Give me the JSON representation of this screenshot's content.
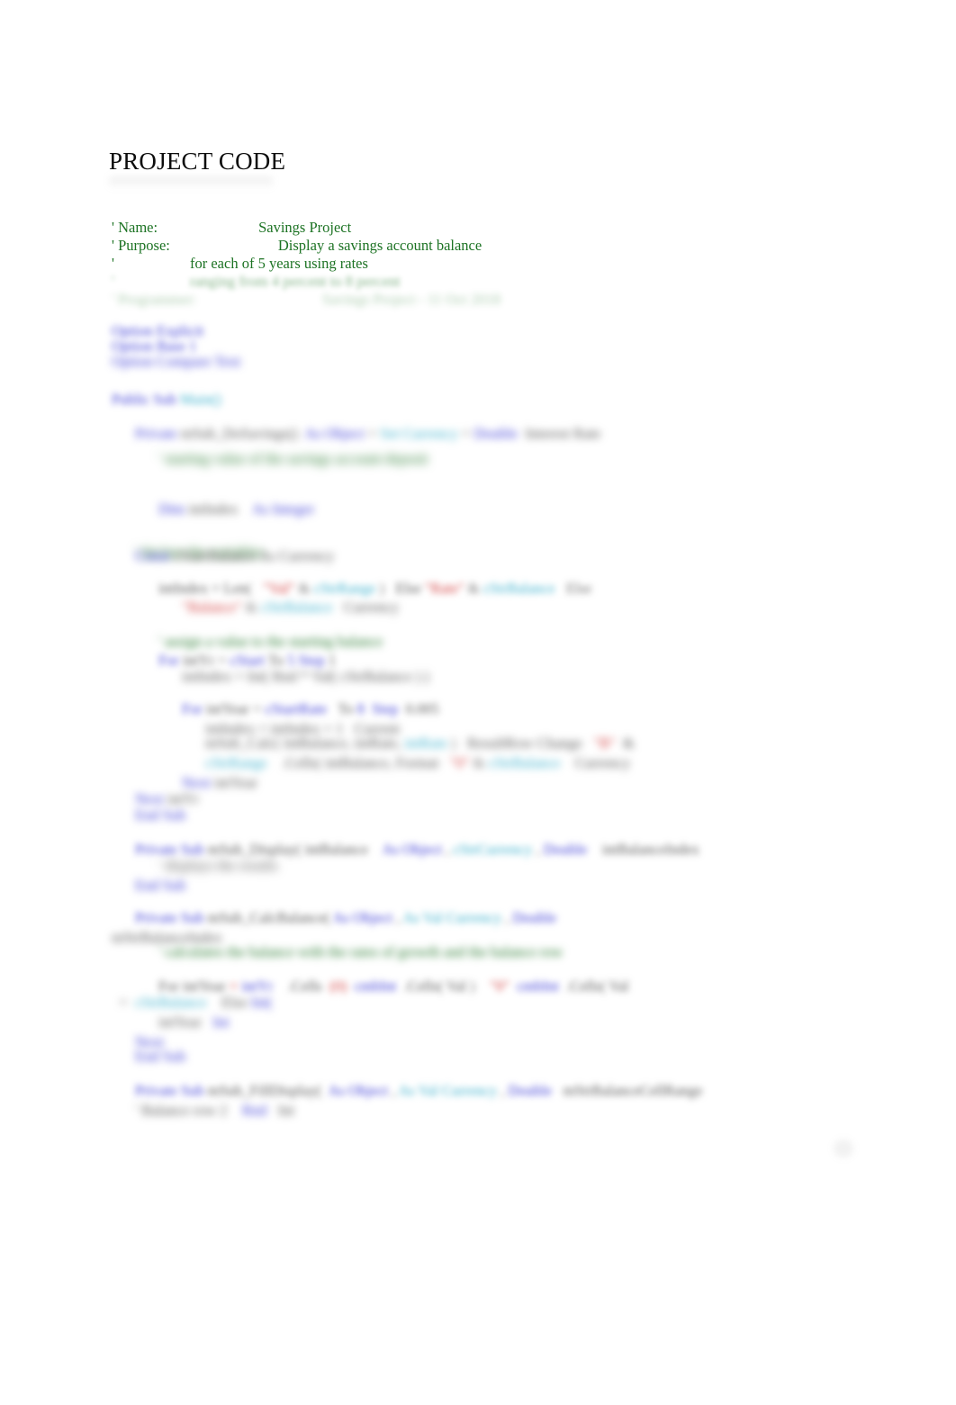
{
  "document": {
    "title": "PROJECT CODE",
    "page_marker": "1"
  },
  "colors": {
    "comment": "#1d7324",
    "keyword": "#3b3bd6",
    "identifier": "#555555",
    "type": "#37aecb",
    "string": "#d03b3b",
    "punctuation": "#6d6d6d",
    "text": "#0d0d0d",
    "background": "#ffffff"
  },
  "header_comments": [
    {
      "label": "' Name:",
      "value": "Savings Project"
    },
    {
      "label": "' Purpose:",
      "value": "Display a savings account balance"
    },
    {
      "label": "'",
      "value": "for each of 5 years using rates"
    },
    {
      "label": "'",
      "value": "ranging from 4 percent to 8 percent"
    },
    {
      "label": "' Programmer:",
      "value": "Savings Project - 11 Oct 2018"
    }
  ],
  "code_lines": [
    {
      "indent": 0,
      "blur": 3,
      "tokens": [
        {
          "cls": "t-kw",
          "text": "Option Explicit"
        }
      ]
    },
    {
      "indent": 0,
      "blur": 3,
      "tokens": [
        {
          "cls": "t-kw",
          "text": "Option Base 1"
        }
      ]
    },
    {
      "indent": 0,
      "blur": 4,
      "tokens": [
        {
          "cls": "t-kw",
          "text": "Option Compare Text"
        }
      ]
    },
    {
      "indent": 0,
      "blur": 3,
      "tokens": [
        {
          "cls": "t-kw",
          "text": "Public Sub "
        },
        {
          "cls": "t-type",
          "text": "Main()"
        }
      ]
    },
    {
      "indent": 1,
      "blur": 4,
      "tokens": [
        {
          "cls": "t-kw",
          "text": "Private "
        },
        {
          "cls": "t-id",
          "text": "mSub_DoSavings()  "
        },
        {
          "cls": "t-kw",
          "text": "As Object"
        },
        {
          "cls": "t-pun",
          "text": " = "
        },
        {
          "cls": "t-type",
          "text": "Set Currency"
        },
        {
          "cls": "t-pun",
          "text": " = "
        },
        {
          "cls": "t-kw",
          "text": "Double"
        },
        {
          "cls": "t-id",
          "text": "  Interest Rate"
        }
      ]
    },
    {
      "indent": 2,
      "blur": 5,
      "tokens": [
        {
          "cls": "t-cmt",
          "text": "' starting value of the savings account deposit"
        }
      ]
    },
    {
      "indent": 2,
      "blur": 4,
      "tokens": [
        {
          "cls": "t-kw",
          "text": "Dim "
        },
        {
          "cls": "t-id",
          "text": "intIndex    "
        },
        {
          "cls": "t-kw",
          "text": "As Integer"
        }
      ]
    },
    {
      "indent": 1,
      "blur": 5,
      "tokens": [
        {
          "cls": "t-cmt",
          "text": "' declare the variables"
        }
      ]
    },
    {
      "indent": 1,
      "blur": 4,
      "tokens": [
        {
          "cls": "t-kw",
          "text": "Const "
        },
        {
          "cls": "t-id",
          "text": "cStartBalance As Currency"
        }
      ]
    },
    {
      "indent": 2,
      "blur": 3,
      "tokens": [
        {
          "cls": "t-id",
          "text": "intIndex = Len"
        },
        {
          "cls": "t-pun",
          "text": "(   "
        },
        {
          "cls": "t-str",
          "text": "\"Val\""
        },
        {
          "cls": "t-pun",
          "text": " & "
        },
        {
          "cls": "t-type",
          "text": "cStrRange"
        },
        {
          "cls": "t-pun",
          "text": " )   "
        },
        {
          "cls": "t-id",
          "text": "Else "
        },
        {
          "cls": "t-str",
          "text": "\"Rate\""
        },
        {
          "cls": "t-pun",
          "text": " & "
        },
        {
          "cls": "t-type",
          "text": "cStrBalance"
        },
        {
          "cls": "t-pun",
          "text": "   Else"
        }
      ]
    },
    {
      "indent": 3,
      "blur": 4,
      "tokens": [
        {
          "cls": "t-str",
          "text": "\"Balance\""
        },
        {
          "cls": "t-pun",
          "text": " & "
        },
        {
          "cls": "t-type",
          "text": "cStrBalance"
        },
        {
          "cls": "t-id",
          "text": "   Currency"
        }
      ]
    },
    {
      "indent": 2,
      "blur": 4,
      "tokens": [
        {
          "cls": "t-cmt",
          "text": "' assign a value to the starting balance"
        }
      ]
    },
    {
      "indent": 2,
      "blur": 3,
      "tokens": [
        {
          "cls": "t-kw",
          "text": "For "
        },
        {
          "cls": "t-id",
          "text": "intYr"
        },
        {
          "cls": "t-pun",
          "text": " = "
        },
        {
          "cls": "t-kw",
          "text": "cStart "
        },
        {
          "cls": "t-id",
          "text": "To "
        },
        {
          "cls": "t-kw",
          "text": "5 "
        },
        {
          "cls": "t-kw",
          "text": "Step "
        },
        {
          "cls": "t-id",
          "text": "1"
        }
      ]
    },
    {
      "indent": 3,
      "blur": 4,
      "tokens": [
        {
          "cls": "t-id",
          "text": "intIndex = Int( Rnd * Val( cStrBalance ) )"
        }
      ]
    },
    {
      "indent": 3,
      "blur": 3,
      "tokens": [
        {
          "cls": "t-kw",
          "text": "For "
        },
        {
          "cls": "t-id",
          "text": "intYear"
        },
        {
          "cls": "t-pun",
          "text": " = "
        },
        {
          "cls": "t-kw",
          "text": "cStartRate"
        },
        {
          "cls": "t-id",
          "text": "   To "
        },
        {
          "cls": "t-kw",
          "text": "8  "
        },
        {
          "cls": "t-kw",
          "text": "Step"
        },
        {
          "cls": "t-id",
          "text": "  0.005"
        }
      ]
    },
    {
      "indent": 4,
      "blur": 4,
      "tokens": [
        {
          "cls": "t-id",
          "text": "intIndex = intIndex + 1   Current"
        }
      ]
    },
    {
      "indent": 4,
      "blur": 4,
      "tokens": [
        {
          "cls": "t-id",
          "text": "mSub_Calc( intBalance, intRate, "
        },
        {
          "cls": "t-type",
          "text": "intRate"
        },
        {
          "cls": "t-pun",
          "text": " ) "
        },
        {
          "cls": "t-id",
          "text": "  ResultRow Change"
        },
        {
          "cls": "t-str",
          "text": "   \"B\""
        },
        {
          "cls": "t-id",
          "text": "  &"
        }
      ]
    },
    {
      "indent": 4,
      "blur": 4,
      "tokens": [
        {
          "cls": "t-type",
          "text": "cStrRange"
        },
        {
          "cls": "t-id",
          "text": "    .Cells( intBalance, Format"
        },
        {
          "cls": "t-str",
          "text": "   \"0\""
        },
        {
          "cls": "t-pun",
          "text": " & "
        },
        {
          "cls": "t-type",
          "text": "cStrBalance"
        },
        {
          "cls": "t-id",
          "text": "    Currency"
        }
      ]
    },
    {
      "indent": 3,
      "blur": 4,
      "tokens": [
        {
          "cls": "t-kw",
          "text": "Next "
        },
        {
          "cls": "t-id",
          "text": "intYear"
        }
      ]
    },
    {
      "indent": 1,
      "blur": 4,
      "tokens": [
        {
          "cls": "t-kw",
          "text": "Next"
        },
        {
          "cls": "t-id",
          "text": " intYr"
        }
      ]
    },
    {
      "indent": 1,
      "blur": 4,
      "tokens": [
        {
          "cls": "t-kw",
          "text": "End Sub"
        }
      ]
    },
    {
      "indent": 1,
      "blur": 3,
      "tokens": [
        {
          "cls": "t-kw",
          "text": "Private Sub "
        },
        {
          "cls": "t-id",
          "text": "mSub_Display( intBalance    "
        },
        {
          "cls": "t-kw",
          "text": "As Object"
        },
        {
          "cls": "t-pun",
          "text": " , "
        },
        {
          "cls": "t-type",
          "text": "cStrCurrency"
        },
        {
          "cls": "t-pun",
          "text": " , "
        },
        {
          "cls": "t-kw",
          "text": "Double"
        },
        {
          "cls": "t-id",
          "text": "    intBalanceIndex"
        }
      ]
    },
    {
      "indent": 2,
      "blur": 5,
      "tokens": [
        {
          "cls": "t-id",
          "text": "' displays the results"
        }
      ]
    },
    {
      "indent": 1,
      "blur": 4,
      "tokens": [
        {
          "cls": "t-kw",
          "text": "End Sub"
        }
      ]
    },
    {
      "indent": 1,
      "blur": 3,
      "tokens": [
        {
          "cls": "t-kw",
          "text": "Private Sub "
        },
        {
          "cls": "t-id",
          "text": "mSub_CalcBalance( "
        },
        {
          "cls": "t-kw",
          "text": "As Object"
        },
        {
          "cls": "t-pun",
          "text": " , "
        },
        {
          "cls": "t-type",
          "text": "As Val Currency"
        },
        {
          "cls": "t-pun",
          "text": " , "
        },
        {
          "cls": "t-kw",
          "text": "Double"
        }
      ]
    },
    {
      "indent": 0,
      "blur": 4,
      "tokens": [
        {
          "cls": "t-id",
          "text": "mStrBalanceIndex"
        }
      ]
    },
    {
      "indent": 2,
      "blur": 4,
      "tokens": [
        {
          "cls": "t-cmt",
          "text": "' calculates the balance with the rates of growth and the balance row"
        }
      ]
    },
    {
      "indent": 2,
      "blur": 3,
      "tokens": [
        {
          "cls": "t-id",
          "text": "For intYear "
        },
        {
          "cls": "t-str",
          "text": "= "
        },
        {
          "cls": "t-kw",
          "text": "intYr"
        },
        {
          "cls": "t-id",
          "text": "    .Cells"
        },
        {
          "cls": "t-pun",
          "text": "  "
        },
        {
          "cls": "t-str",
          "text": "(0)"
        },
        {
          "cls": "t-kw",
          "text": "  cmbInt"
        },
        {
          "cls": "t-id",
          "text": "  .Cells( Val"
        },
        {
          "cls": "t-pun",
          "text": " )    "
        },
        {
          "cls": "t-str",
          "text": "\"0\""
        },
        {
          "cls": "t-kw",
          "text": "  cmbInt"
        },
        {
          "cls": "t-id",
          "text": "  .Cells( Val"
        }
      ]
    },
    {
      "indent": 0,
      "blur": 4,
      "tokens": [
        {
          "cls": "t-pun",
          "text": "  =  "
        },
        {
          "cls": "t-type",
          "text": "cStrBalance"
        },
        {
          "cls": "t-id",
          "text": "    Else "
        },
        {
          "cls": "t-kw",
          "text": "Int("
        }
      ]
    },
    {
      "indent": 2,
      "blur": 4,
      "tokens": [
        {
          "cls": "t-id",
          "text": "intYear"
        },
        {
          "cls": "t-kw",
          "text": "   Int"
        }
      ]
    },
    {
      "indent": 1,
      "blur": 4,
      "tokens": [
        {
          "cls": "t-kw",
          "text": "Next"
        }
      ]
    },
    {
      "indent": 1,
      "blur": 4,
      "tokens": [
        {
          "cls": "t-kw",
          "text": "End Sub"
        }
      ]
    },
    {
      "indent": 1,
      "blur": 3,
      "tokens": [
        {
          "cls": "t-kw",
          "text": "Private Sub "
        },
        {
          "cls": "t-id",
          "text": "mSub_FillDisplay(  "
        },
        {
          "cls": "t-kw",
          "text": "As Object"
        },
        {
          "cls": "t-pun",
          "text": " , "
        },
        {
          "cls": "t-type",
          "text": "As Val Currency"
        },
        {
          "cls": "t-pun",
          "text": " , "
        },
        {
          "cls": "t-kw",
          "text": "Double"
        },
        {
          "cls": "t-id",
          "text": "   mStrBalanceCellRange"
        }
      ]
    },
    {
      "indent": 1,
      "blur": 4,
      "tokens": [
        {
          "cls": "t-id",
          "text": "' Balance row 2    "
        },
        {
          "cls": "t-kw",
          "text": "Rnd"
        },
        {
          "cls": "t-id",
          "text": "   Int"
        }
      ]
    }
  ]
}
